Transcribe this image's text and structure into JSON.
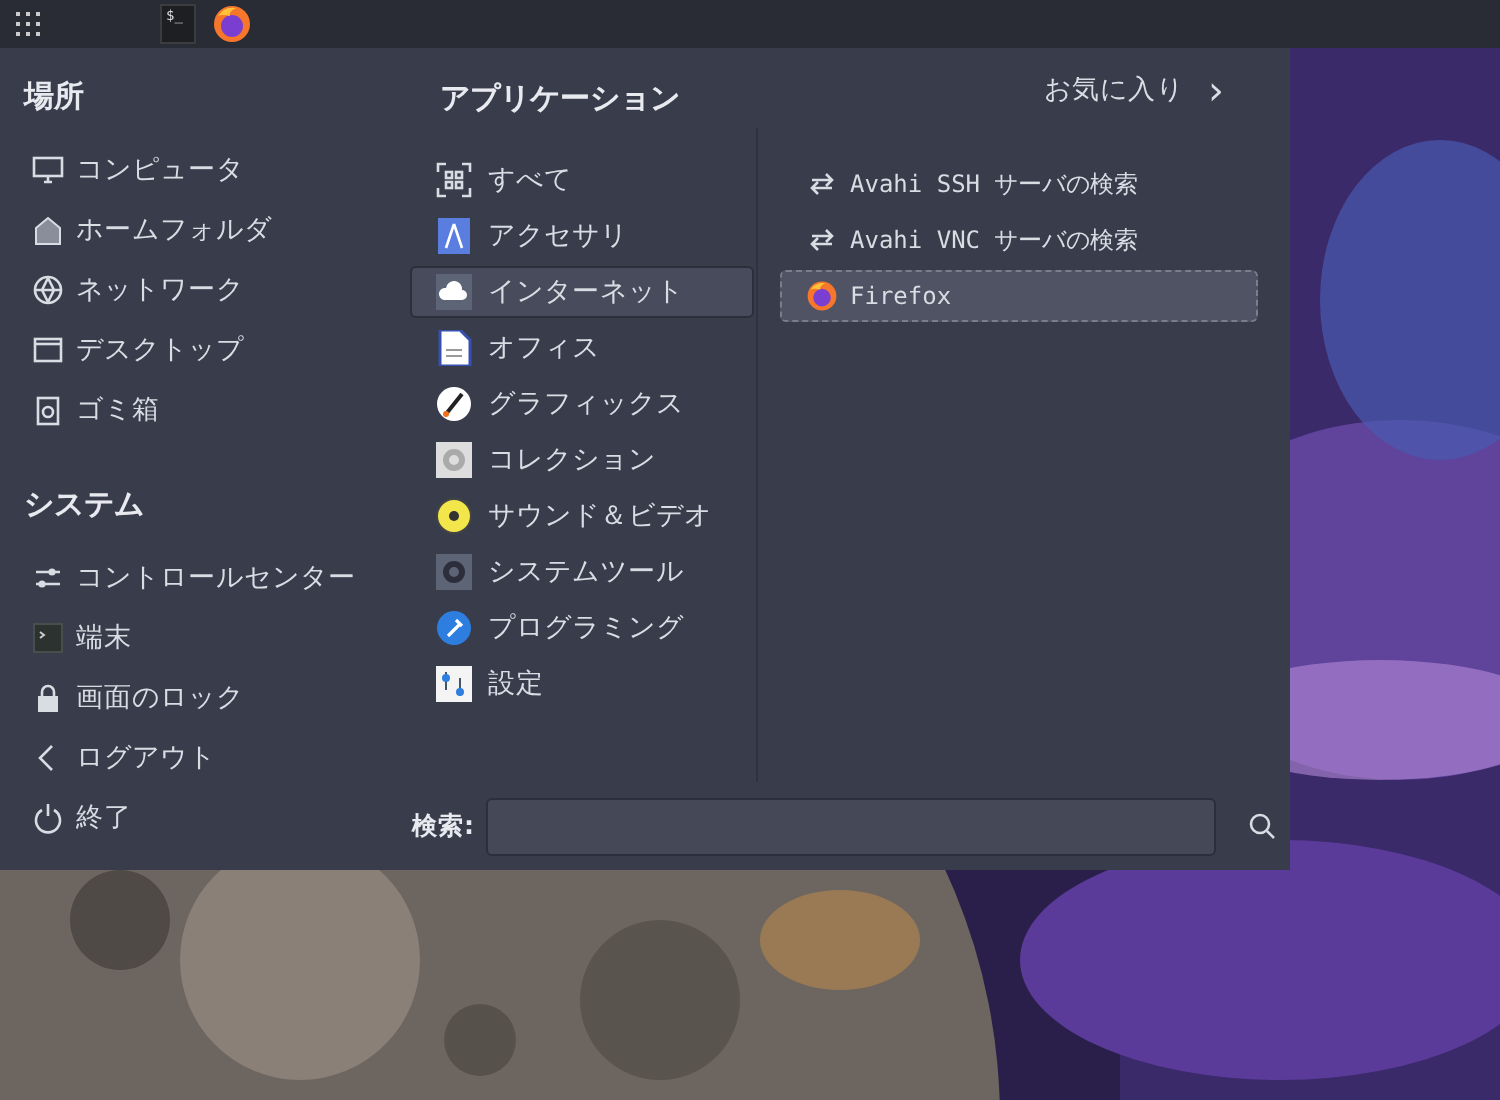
{
  "panel": {
    "terminal_label": "$_"
  },
  "places": {
    "title": "場所",
    "items": [
      {
        "label": "コンピュータ"
      },
      {
        "label": "ホームフォルダ"
      },
      {
        "label": "ネットワーク"
      },
      {
        "label": "デスクトップ"
      },
      {
        "label": "ゴミ箱"
      }
    ]
  },
  "system": {
    "title": "システム",
    "items": [
      {
        "label": "コントロールセンター"
      },
      {
        "label": "端末"
      },
      {
        "label": "画面のロック"
      },
      {
        "label": "ログアウト"
      },
      {
        "label": "終了"
      }
    ]
  },
  "applications": {
    "title": "アプリケーション",
    "categories": [
      {
        "label": "すべて",
        "selected": false
      },
      {
        "label": "アクセサリ",
        "selected": false
      },
      {
        "label": "インターネット",
        "selected": true
      },
      {
        "label": "オフィス",
        "selected": false
      },
      {
        "label": "グラフィックス",
        "selected": false
      },
      {
        "label": "コレクション",
        "selected": false
      },
      {
        "label": "サウンド＆ビデオ",
        "selected": false
      },
      {
        "label": "システムツール",
        "selected": false
      },
      {
        "label": "プログラミング",
        "selected": false
      },
      {
        "label": "設定",
        "selected": false
      }
    ]
  },
  "favorites_link": {
    "label": "お気に入り",
    "arrow": "›"
  },
  "apps": [
    {
      "label": "Avahi SSH サーバの検索",
      "kind": "arrows",
      "selected": false
    },
    {
      "label": "Avahi VNC サーバの検索",
      "kind": "arrows",
      "selected": false
    },
    {
      "label": "Firefox",
      "kind": "firefox",
      "selected": true
    }
  ],
  "search": {
    "label": "検索:"
  }
}
